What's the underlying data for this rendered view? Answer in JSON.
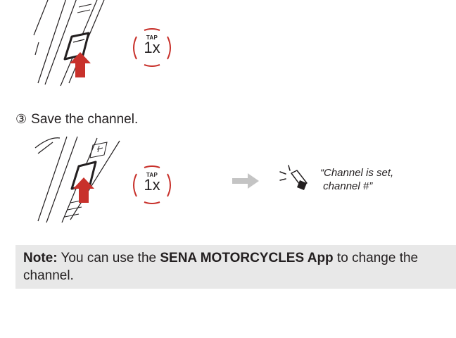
{
  "colors": {
    "accent": "#c8312b",
    "arrow": "#c4c4c4",
    "note_bg": "#e8e8e8",
    "text": "#231f20"
  },
  "step1": {
    "tap": {
      "label": "TAP",
      "count": "1x"
    }
  },
  "step3": {
    "number": "③",
    "text": "Save the channel.",
    "tap": {
      "label": "TAP",
      "count": "1x"
    },
    "voice_prompt": "“Channel is set,\n channel #”"
  },
  "note": {
    "prefix": "Note:",
    "text_before": " You can use the ",
    "app_name": "SENA MOTORCYCLES App",
    "text_after": " to change the",
    "line2": "channel."
  },
  "icons": [
    "device-illustration",
    "tap-icon",
    "arrow-right-icon",
    "speaker-icon"
  ]
}
